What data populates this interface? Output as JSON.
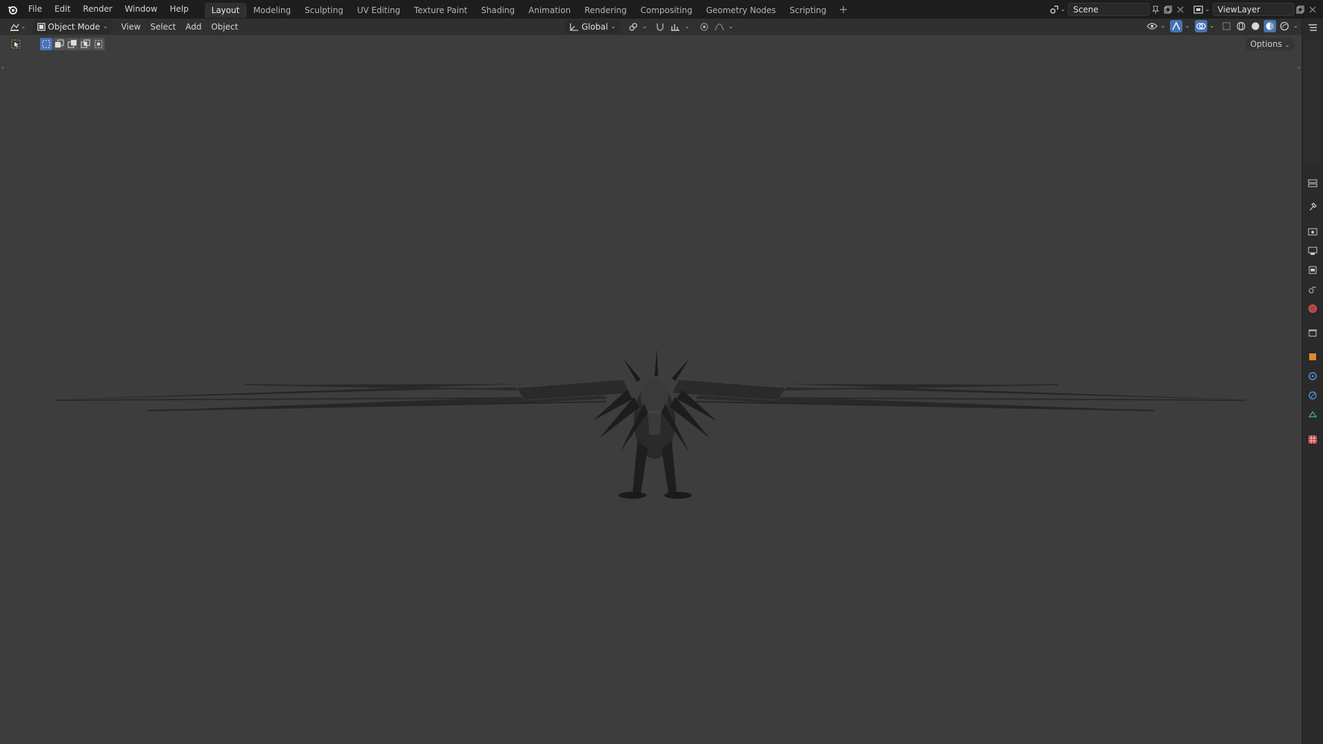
{
  "menu": [
    "File",
    "Edit",
    "Render",
    "Window",
    "Help"
  ],
  "workspaces": [
    {
      "label": "Layout",
      "active": true
    },
    {
      "label": "Modeling"
    },
    {
      "label": "Sculpting"
    },
    {
      "label": "UV Editing"
    },
    {
      "label": "Texture Paint"
    },
    {
      "label": "Shading"
    },
    {
      "label": "Animation"
    },
    {
      "label": "Rendering"
    },
    {
      "label": "Compositing"
    },
    {
      "label": "Geometry Nodes"
    },
    {
      "label": "Scripting"
    }
  ],
  "add_workspace": "+",
  "scene": {
    "name": "Scene"
  },
  "view_layer": {
    "name": "ViewLayer"
  },
  "header": {
    "mode": "Object Mode",
    "menus": [
      "View",
      "Select",
      "Add",
      "Object"
    ],
    "orientation": "Global"
  },
  "options_label": "Options",
  "colors": {
    "topbar": "#1d1d1d",
    "header": "#303030",
    "viewport": "#3d3d3d",
    "accent": "#4772b3"
  },
  "property_icons": [
    "tool-icon",
    "render-icon",
    "output-icon",
    "view-layer-icon",
    "scene-icon",
    "world-icon",
    "collection-icon",
    "object-icon",
    "modifier-icon",
    "physics-icon",
    "constraints-icon",
    "data-icon",
    "texture-icon"
  ]
}
